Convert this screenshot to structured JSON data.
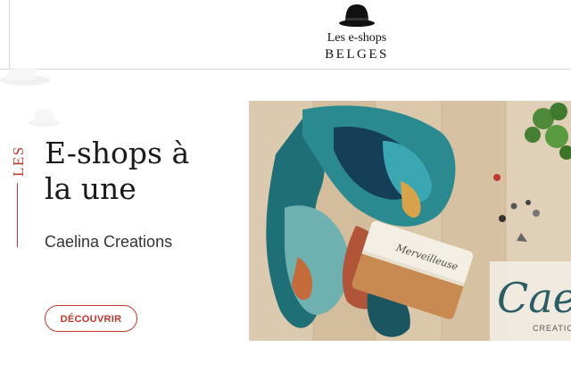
{
  "header": {
    "logo_line1": "Les e-shops",
    "logo_line2": "BELGES"
  },
  "featured": {
    "side_label": "LES",
    "title_line1": "E-shops à",
    "title_line2": "la une",
    "shop_name": "Caelina Creations",
    "cta_label": "DÉCOUVRIR",
    "image": {
      "pouch_text": "Merveilleuse",
      "brand_script": "Caeli",
      "brand_caption": "CREATIO"
    }
  },
  "colors": {
    "accent": "#c0392b",
    "text": "#1a1a1a",
    "border": "#d9d9d9"
  }
}
